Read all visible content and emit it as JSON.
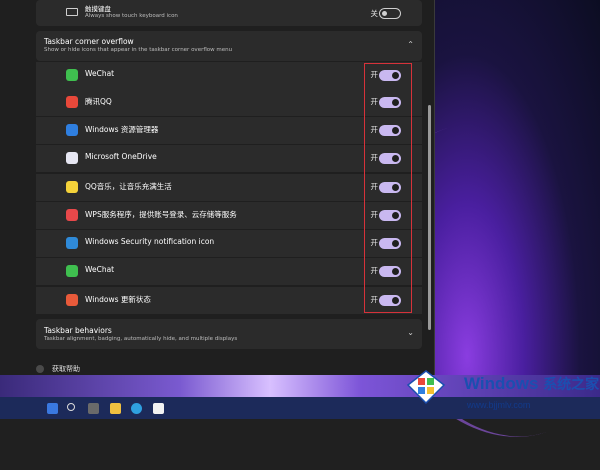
{
  "touch_keyboard": {
    "title": "触摸键盘",
    "subtitle": "Always show touch keyboard icon",
    "toggle_label": "关"
  },
  "overflow_section": {
    "title": "Taskbar corner overflow",
    "subtitle": "Show or hide icons that appear in the taskbar corner overflow menu",
    "items": [
      {
        "label": "WeChat",
        "toggle_label": "开",
        "color": "#3fbf4f"
      },
      {
        "label": "腾讯QQ",
        "toggle_label": "开",
        "color": "#e8483a"
      },
      {
        "label": "Windows 资源管理器",
        "toggle_label": "开",
        "color": "#2f7fe0"
      },
      {
        "label": "Microsoft OneDrive",
        "toggle_label": "开",
        "color": "#e6e6f2"
      },
      {
        "label": "QQ音乐，让音乐充满生活",
        "toggle_label": "开",
        "color": "#f4d23a"
      },
      {
        "label": "WPS服务程序，提供账号登录、云存储等服务",
        "toggle_label": "开",
        "color": "#e8484a"
      },
      {
        "label": "Windows Security notification icon",
        "toggle_label": "开",
        "color": "#2f8ad8"
      },
      {
        "label": "WeChat",
        "toggle_label": "开",
        "color": "#3fbf4f"
      },
      {
        "label": "Windows 更新状态",
        "toggle_label": "开",
        "color": "#e85a3a"
      }
    ]
  },
  "behaviors_section": {
    "title": "Taskbar behaviors",
    "subtitle": "Taskbar alignment, badging, automatically hide, and multiple displays"
  },
  "help": {
    "label": "获取帮助"
  },
  "watermark": {
    "brand": "Windows",
    "brand_cn": "系统之家",
    "url": "www.bjjmlv.com"
  }
}
